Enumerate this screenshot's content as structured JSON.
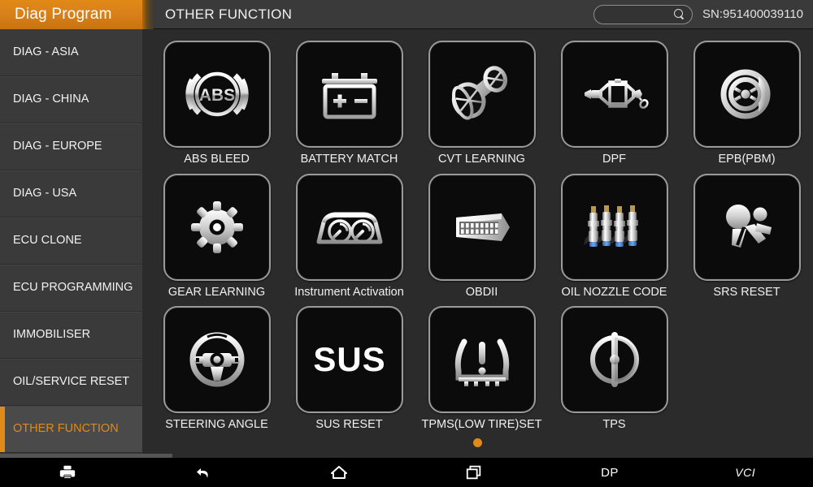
{
  "brand": {
    "label": "Diag Program"
  },
  "header": {
    "title": "OTHER FUNCTION",
    "serial": "SN:951400039110",
    "search": {
      "value": "",
      "placeholder": ""
    }
  },
  "sidebar": {
    "items": [
      {
        "label": "DIAG - ASIA",
        "active": false
      },
      {
        "label": "DIAG - CHINA",
        "active": false
      },
      {
        "label": "DIAG - EUROPE",
        "active": false
      },
      {
        "label": "DIAG - USA",
        "active": false
      },
      {
        "label": "ECU CLONE",
        "active": false
      },
      {
        "label": "ECU PROGRAMMING",
        "active": false
      },
      {
        "label": "IMMOBILISER",
        "active": false
      },
      {
        "label": "OIL/SERVICE RESET",
        "active": false
      },
      {
        "label": "OTHER FUNCTION",
        "active": true
      }
    ]
  },
  "main": {
    "tiles": [
      {
        "label": "ABS BLEED",
        "icon": "abs-icon"
      },
      {
        "label": "BATTERY MATCH",
        "icon": "battery-icon"
      },
      {
        "label": "CVT LEARNING",
        "icon": "cvt-pulley-icon"
      },
      {
        "label": "DPF",
        "icon": "dpf-filter-icon"
      },
      {
        "label": "EPB(PBM)",
        "icon": "brake-disc-icon"
      },
      {
        "label": "GEAR LEARNING",
        "icon": "gear-icon"
      },
      {
        "label": "Instrument Activation",
        "icon": "instrument-cluster-icon"
      },
      {
        "label": "OBDII",
        "icon": "obd-connector-icon"
      },
      {
        "label": "OIL NOZZLE CODE",
        "icon": "fuel-injectors-icon"
      },
      {
        "label": "SRS RESET",
        "icon": "airbag-icon"
      },
      {
        "label": "STEERING ANGLE",
        "icon": "steering-wheel-icon"
      },
      {
        "label": "SUS RESET",
        "icon": "sus-text-icon"
      },
      {
        "label": "TPMS(LOW TIRE)SET",
        "icon": "tpms-warning-icon"
      },
      {
        "label": "TPS",
        "icon": "throttle-position-icon"
      }
    ],
    "pager": {
      "pages": 1,
      "current": 1
    }
  },
  "navbar": {
    "items": [
      {
        "label": "",
        "icon": "print-icon"
      },
      {
        "label": "",
        "icon": "back-arrow-icon"
      },
      {
        "label": "",
        "icon": "home-icon"
      },
      {
        "label": "",
        "icon": "recents-icon"
      },
      {
        "label": "DP",
        "icon": ""
      },
      {
        "label": "VCI",
        "icon": ""
      }
    ]
  },
  "colors": {
    "accent": "#e08a18",
    "sidebar_bg": "#3a3a3a",
    "content_bg": "#2b2b2b",
    "tile_bg": "#0b0b0b",
    "navbar_bg": "#000000"
  }
}
